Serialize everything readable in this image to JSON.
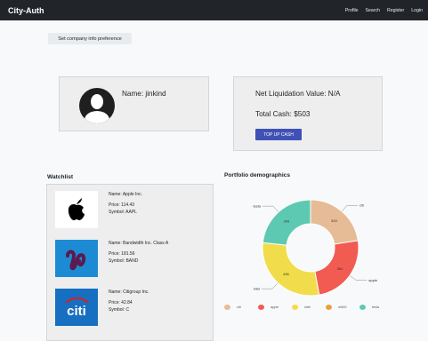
{
  "app": {
    "brand": "City-Auth"
  },
  "nav": {
    "items": [
      "Profile",
      "Search",
      "Register",
      "Login"
    ]
  },
  "preference_button": "Set company info preference",
  "profile": {
    "name_line": "Name: jinkind"
  },
  "account": {
    "net_liquidation": "Net Liquidation Value: N/A",
    "total_cash": "Total Cash: $503",
    "top_up_label": "TOP UP CASH"
  },
  "watchlist": {
    "title": "Watchlist",
    "items": [
      {
        "name": "Name: Apple Inc.",
        "price": "Price: 114.43",
        "symbol": "Symbol: AAPL",
        "logo": "apple-logo"
      },
      {
        "name": "Name: Bandwidth Inc. Class A",
        "price": "Price: 181.56",
        "symbol": "Symbol: BAND",
        "logo": "bandwidth-logo"
      },
      {
        "name": "Name: Citigroup Inc.",
        "price": "Price: 42.84",
        "symbol": "Symbol: C",
        "logo": "citi-logo"
      }
    ]
  },
  "portfolio": {
    "title": "Portfolio demographics",
    "colors": {
      "citi": "#e5bc96",
      "apple": "#f25b52",
      "intel": "#f1dc4c",
      "m500": "#e8a23a",
      "tesla": "#5ec9b2"
    }
  },
  "chart_data": {
    "type": "pie",
    "title": "Portfolio demographics",
    "categories": [
      "citi",
      "apple",
      "intel",
      "m500",
      "tesla"
    ],
    "values": [
      333,
      361,
      436,
      0,
      343
    ],
    "legend": "bottom"
  }
}
